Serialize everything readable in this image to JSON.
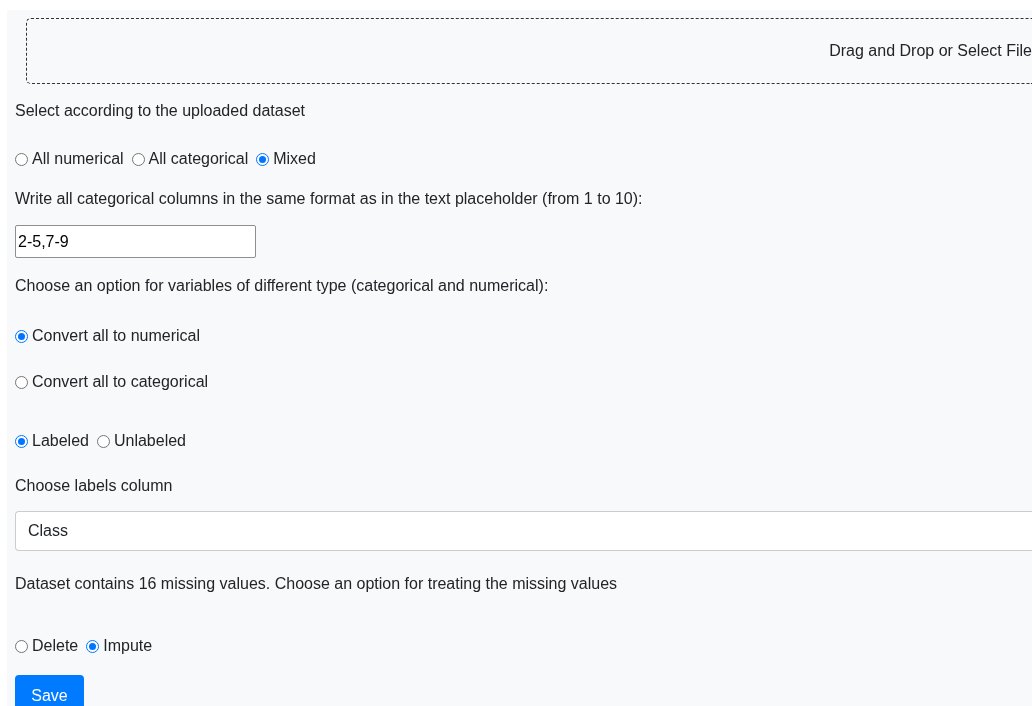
{
  "upload": {
    "label": "Drag and Drop or Select File"
  },
  "dataset_type": {
    "label": "Select according to the uploaded dataset",
    "options": [
      {
        "label": "All numerical",
        "selected": false
      },
      {
        "label": "All categorical",
        "selected": false
      },
      {
        "label": "Mixed",
        "selected": true
      }
    ]
  },
  "categorical_columns": {
    "label": "Write all categorical columns in the same format as in the text placeholder (from 1 to 10):",
    "value": "2-5,7-9"
  },
  "conversion": {
    "label": "Choose an option for variables of different type (categorical and numerical):",
    "options": [
      {
        "label": "Convert all to numerical",
        "selected": true
      },
      {
        "label": "Convert all to categorical",
        "selected": false
      }
    ]
  },
  "labeling": {
    "options": [
      {
        "label": "Labeled",
        "selected": true
      },
      {
        "label": "Unlabeled",
        "selected": false
      }
    ]
  },
  "labels_column": {
    "label": "Choose labels column",
    "value": "Class"
  },
  "missing": {
    "label": "Dataset contains 16 missing values. Choose an option for treating the missing values",
    "options": [
      {
        "label": "Delete",
        "selected": false
      },
      {
        "label": "Impute",
        "selected": true
      }
    ]
  },
  "save_button": "Save"
}
